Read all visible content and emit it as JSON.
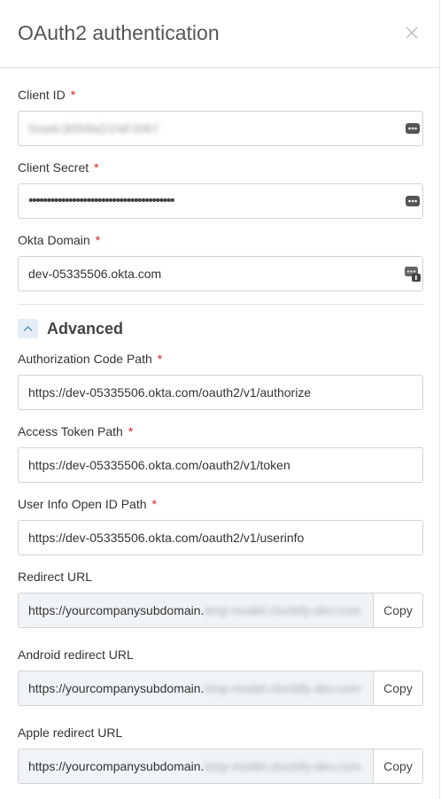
{
  "header": {
    "title": "OAuth2 authentication"
  },
  "fields": {
    "client_id": {
      "label": "Client ID",
      "value": "0oa4c3t5h8sD1NF2067"
    },
    "client_secret": {
      "label": "Client Secret",
      "value": "••••••••••••••••••••••••••••••••••••••••"
    },
    "okta_domain": {
      "label": "Okta Domain",
      "value": "dev-05335506.okta.com"
    }
  },
  "advanced": {
    "title": "Advanced",
    "auth_code_path": {
      "label": "Authorization Code Path",
      "value": "https://dev-05335506.okta.com/oauth2/v1/authorize"
    },
    "access_token_path": {
      "label": "Access Token Path",
      "value": "https://dev-05335506.okta.com/oauth2/v1/token"
    },
    "userinfo_path": {
      "label": "User Info Open ID Path",
      "value": "https://dev-05335506.okta.com/oauth2/v1/userinfo"
    },
    "redirect_url": {
      "label": "Redirect URL",
      "value": "https://yourcompanysubdomain.",
      "hidden": "kmp-model.clockify-dev.com",
      "copy": "Copy"
    },
    "android_redirect_url": {
      "label": "Android redirect URL",
      "value": "https://yourcompanysubdomain.",
      "hidden": "kmp-model.clockify-dev.com",
      "copy": "Copy"
    },
    "apple_redirect_url": {
      "label": "Apple redirect URL",
      "value": "https://yourcompanysubdomain.",
      "hidden": "kmp-model.clockify-dev.com",
      "copy": "Copy"
    }
  },
  "required_mark": "*",
  "colors": {
    "required": "#e0201a",
    "readonly_bg": "#f1f4f7",
    "toggle_bg": "#e5eef6"
  }
}
